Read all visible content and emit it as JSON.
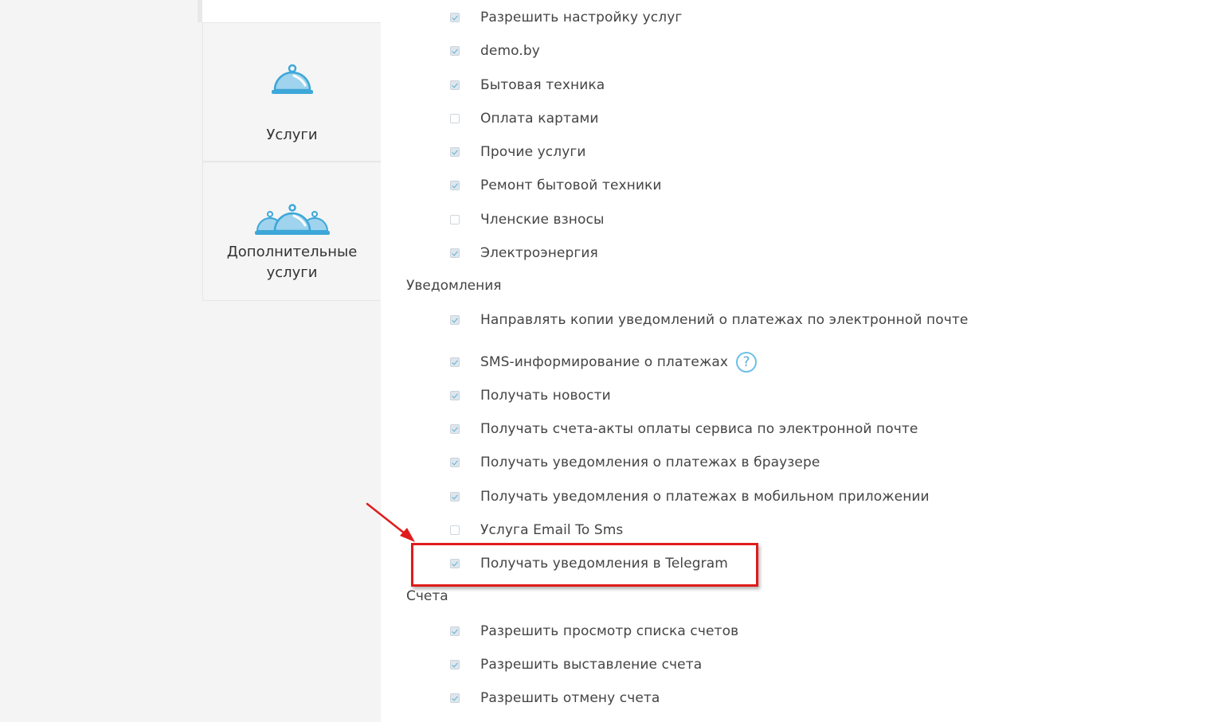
{
  "sidebar": {
    "tiles": [
      {
        "label": "Услуги",
        "icon": "cloche-icon"
      },
      {
        "label": "Дополнительные\nуслуги",
        "icon": "multiple-cloches-icon"
      }
    ]
  },
  "services": [
    {
      "label": "Разрешить настройку услуг",
      "checked": true
    },
    {
      "label": "demo.by",
      "checked": true
    },
    {
      "label": "Бытовая техника",
      "checked": true
    },
    {
      "label": "Оплата картами",
      "checked": false
    },
    {
      "label": "Прочие услуги",
      "checked": true
    },
    {
      "label": "Ремонт бытовой техники",
      "checked": true
    },
    {
      "label": "Членские взносы",
      "checked": false
    },
    {
      "label": "Электроэнергия",
      "checked": true
    }
  ],
  "notifications": {
    "title": "Уведомления",
    "items": [
      {
        "label": "Направлять копии уведомлений о платежах по электронной почте",
        "checked": true
      },
      {
        "label": "SMS-информирование о платежах",
        "checked": true,
        "help": "?"
      },
      {
        "label": "Получать новости",
        "checked": true
      },
      {
        "label": "Получать счета-акты оплаты сервиса по электронной почте",
        "checked": true
      },
      {
        "label": "Получать уведомления о платежах в браузере",
        "checked": true
      },
      {
        "label": "Получать уведомления о платежах в мобильном приложении",
        "checked": true
      },
      {
        "label": "Услуга Email To Sms",
        "checked": false
      },
      {
        "label": "Получать уведомления в Telegram",
        "checked": true
      }
    ]
  },
  "invoices": {
    "title": "Счета",
    "items": [
      {
        "label": "Разрешить просмотр списка счетов",
        "checked": true
      },
      {
        "label": "Разрешить выставление счета",
        "checked": true
      },
      {
        "label": "Разрешить отмену счета",
        "checked": true
      }
    ]
  },
  "colors": {
    "accent": "#5ab0d8",
    "highlight": "#e01b1b"
  }
}
